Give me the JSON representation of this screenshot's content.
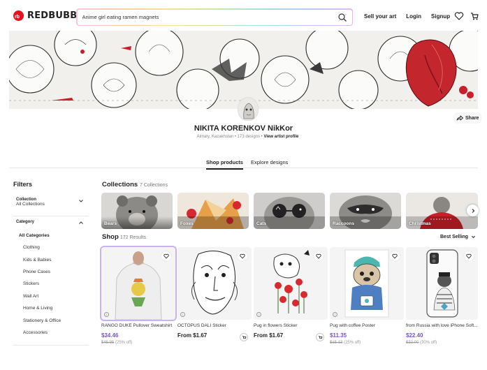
{
  "header": {
    "logo_text": "REDBUBBLE",
    "search_value": "Anime girl eating ramen magnets",
    "nav": [
      "Sell your art",
      "Login",
      "Signup"
    ],
    "icons": [
      "heart-icon",
      "cart-icon"
    ]
  },
  "artist": {
    "name": "NIKITA KORENKOV NikKor",
    "location": "Almaty, Kazakhstan",
    "designs": "173 designs",
    "profile_link": "View artist profile",
    "share_label": "Share"
  },
  "tabs": [
    "Shop products",
    "Explore designs"
  ],
  "filters": {
    "title": "Filters",
    "collection": {
      "label": "Collection",
      "value": "All Collections"
    },
    "category": {
      "label": "Category",
      "items": [
        "All Categories",
        "Clothing",
        "Kids & Babies",
        "Phone Cases",
        "Stickers",
        "Wall Art",
        "Home & Living",
        "Stationery & Office",
        "Accessories"
      ]
    }
  },
  "collections": {
    "title": "Collections",
    "count": "7 Collections",
    "items": [
      "Bears",
      "Foxes",
      "Cats",
      "Raccoons",
      "Christmas"
    ]
  },
  "shop": {
    "title": "Shop",
    "count": "172 Results",
    "sort": "Best Selling",
    "products": [
      {
        "title": "RANGO DUKE Pullover Sweatshirt",
        "price": "$34.46",
        "was": "$45.95",
        "discount": "(25% off)"
      },
      {
        "title": "OCTOPUS DALI Sticker",
        "price": "From $1.67",
        "was": "",
        "discount": ""
      },
      {
        "title": "Pug in flowers Sticker",
        "price": "From $1.67",
        "was": "",
        "discount": ""
      },
      {
        "title": "Pug with coffee Poster",
        "price": "$11.35",
        "was": "$15.13",
        "discount": "(25% off)"
      },
      {
        "title": "from Russia with love iPhone Soft...",
        "price": "$22.40",
        "was": "$32.00",
        "discount": "(30% off)"
      }
    ]
  },
  "colors": {
    "brand": "#e41321",
    "sale": "#7a55c4"
  }
}
